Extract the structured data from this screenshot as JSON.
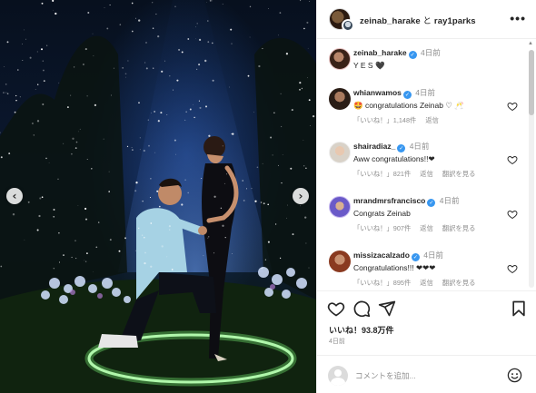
{
  "post": {
    "author": "zeinab_harake",
    "conjunction": "と",
    "collaborator": "ray1parks",
    "caption_user": "zeinab_harake",
    "caption_time": "4日前",
    "caption_text": "Y E S 🖤"
  },
  "comments": [
    {
      "user": "whianwamos",
      "time": "4日前",
      "text": "🤩 congratulations Zeinab ♡ 🥂",
      "likes": "「いいね！」1,148件",
      "reply": "返信",
      "translate": ""
    },
    {
      "user": "shairadiaz_",
      "time": "4日前",
      "text": "Aww congratulations!!❤",
      "likes": "「いいね！」821件",
      "reply": "返信",
      "translate": "翻訳を見る"
    },
    {
      "user": "mrandmrsfrancisco",
      "time": "4日前",
      "text": "Congrats Zeinab",
      "likes": "「いいね！」907件",
      "reply": "返信",
      "translate": "翻訳を見る"
    },
    {
      "user": "missizacalzado",
      "time": "4日前",
      "text": "Congratulations!!! ❤❤❤",
      "likes": "「いいね！」895件",
      "reply": "返信",
      "translate": "翻訳を見る"
    }
  ],
  "footer": {
    "likes_text": "いいね！93.8万件",
    "time_ago": "4日前",
    "comment_placeholder": "コメントを追加..."
  },
  "icons": {
    "like": "heart-icon",
    "comment": "comment-icon",
    "share": "paper-plane-icon",
    "save": "bookmark-icon",
    "emoji": "smiley-icon",
    "more": "more-options-icon",
    "prev": "chevron-left-icon",
    "next": "chevron-right-icon"
  },
  "colors": {
    "verified": "#3897f0",
    "meta_text": "#8e8e8e",
    "text": "#262626"
  }
}
